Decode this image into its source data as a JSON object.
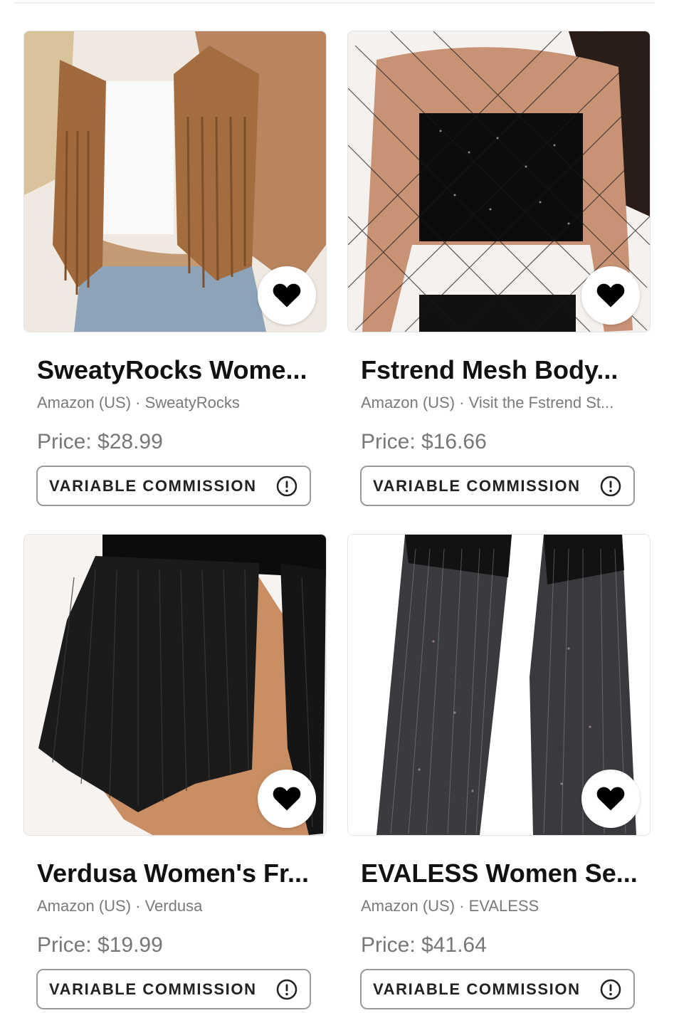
{
  "products": [
    {
      "title": "SweatyRocks Wome...",
      "source": "Amazon (US) · SweatyRocks",
      "price": "Price: $28.99",
      "commission_label": "VARIABLE COMMISSION",
      "image": "fringe-suede-vest",
      "favorite_icon": "heart-icon",
      "info_icon": "info-icon"
    },
    {
      "title": "Fstrend Mesh Body...",
      "source": "Amazon (US) · Visit the Fstrend St...",
      "price": "Price: $16.66",
      "commission_label": "VARIABLE COMMISSION",
      "image": "rhinestone-mesh-top",
      "favorite_icon": "heart-icon",
      "info_icon": "info-icon"
    },
    {
      "title": "Verdusa Women's Fr...",
      "source": "Amazon (US) · Verdusa",
      "price": "Price: $19.99",
      "commission_label": "VARIABLE COMMISSION",
      "image": "black-fringe-skirt",
      "favorite_icon": "heart-icon",
      "info_icon": "info-icon"
    },
    {
      "title": "EVALESS Women Se...",
      "source": "Amazon (US) · EVALESS",
      "price": "Price: $41.64",
      "commission_label": "VARIABLE COMMISSION",
      "image": "sequin-flare-pants",
      "favorite_icon": "heart-icon",
      "info_icon": "info-icon"
    }
  ],
  "colors": {
    "title": "#111111",
    "secondary_text": "#7a7a7a",
    "price_text": "#777777",
    "button_border": "#9a9a9a",
    "heart": "#000000"
  }
}
